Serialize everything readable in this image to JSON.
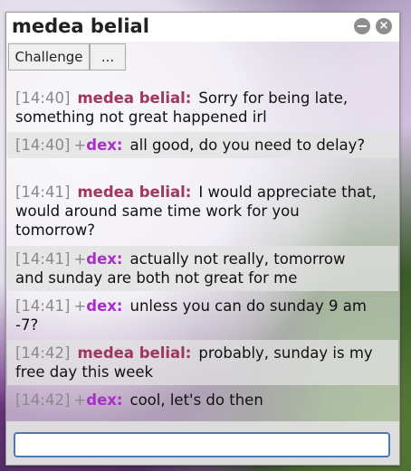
{
  "window": {
    "title": "medea belial",
    "minimize_icon": "minimize-icon",
    "close_icon": "close-icon",
    "close_glyph": "×"
  },
  "toolbar": {
    "challenge_label": "Challenge",
    "more_label": "..."
  },
  "colors": {
    "medea": "#a03560",
    "dex": "#a830c8",
    "timestamp": "#8a8a8a"
  },
  "messages": [
    {
      "time": "[14:40]",
      "rank": "",
      "user": "medea belial:",
      "text": "Sorry for being late, something not great happened irl"
    },
    {
      "time": "[14:40]",
      "rank": "+",
      "user": "dex:",
      "text": "all good, do you need to delay?"
    },
    {
      "time": "[14:41]",
      "rank": "",
      "user": "medea belial:",
      "text": "I would appreciate that, would around same time work for you tomorrow?"
    },
    {
      "time": "[14:41]",
      "rank": "+",
      "user": "dex:",
      "text": "actually not really, tomorrow and sunday are both not great for me"
    },
    {
      "time": "[14:41]",
      "rank": "+",
      "user": "dex:",
      "text": "unless you can do sunday 9 am -7?"
    },
    {
      "time": "[14:42]",
      "rank": "",
      "user": "medea belial:",
      "text": "probably, sunday is my free day this week"
    },
    {
      "time": "[14:42]",
      "rank": "+",
      "user": "dex:",
      "text": "cool, let's do then"
    }
  ],
  "input": {
    "value": "",
    "placeholder": ""
  }
}
